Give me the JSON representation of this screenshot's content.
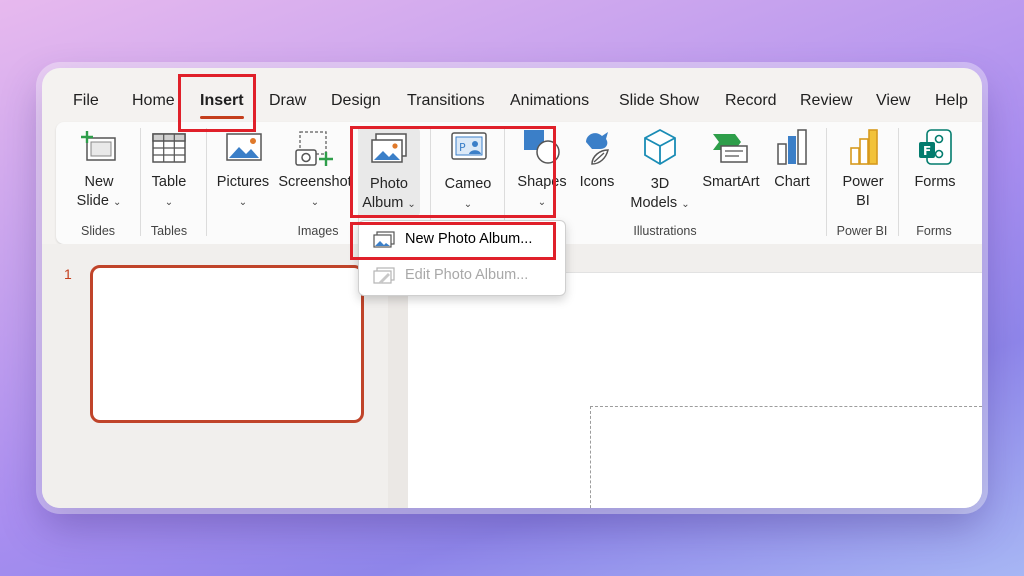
{
  "tabs": [
    "File",
    "Home",
    "Insert",
    "Draw",
    "Design",
    "Transitions",
    "Animations",
    "Slide Show",
    "Record",
    "Review",
    "View",
    "Help"
  ],
  "active_tab": "Insert",
  "ribbon": {
    "new_slide": [
      "New",
      "Slide"
    ],
    "table": "Table",
    "pictures": "Pictures",
    "screenshot": "Screenshot",
    "photo_album": [
      "Photo",
      "Album"
    ],
    "cameo": "Cameo",
    "shapes": "Shapes",
    "icons": "Icons",
    "models": [
      "3D",
      "Models"
    ],
    "smartart": "SmartArt",
    "chart": "Chart",
    "power_bi": [
      "Power",
      "BI"
    ],
    "forms": "Forms",
    "dropdown_chevron": "⌄"
  },
  "groups": {
    "slides": "Slides",
    "tables": "Tables",
    "images": "Images",
    "illustrations": "Illustrations",
    "power_bi": "Power BI",
    "forms": "Forms"
  },
  "photo_album_menu": {
    "new": "New Photo Album...",
    "edit": "Edit Photo Album..."
  },
  "thumbnails": {
    "slide_number": "1"
  },
  "colors": {
    "accent": "#c43e1c",
    "highlight": "#e0202a"
  }
}
